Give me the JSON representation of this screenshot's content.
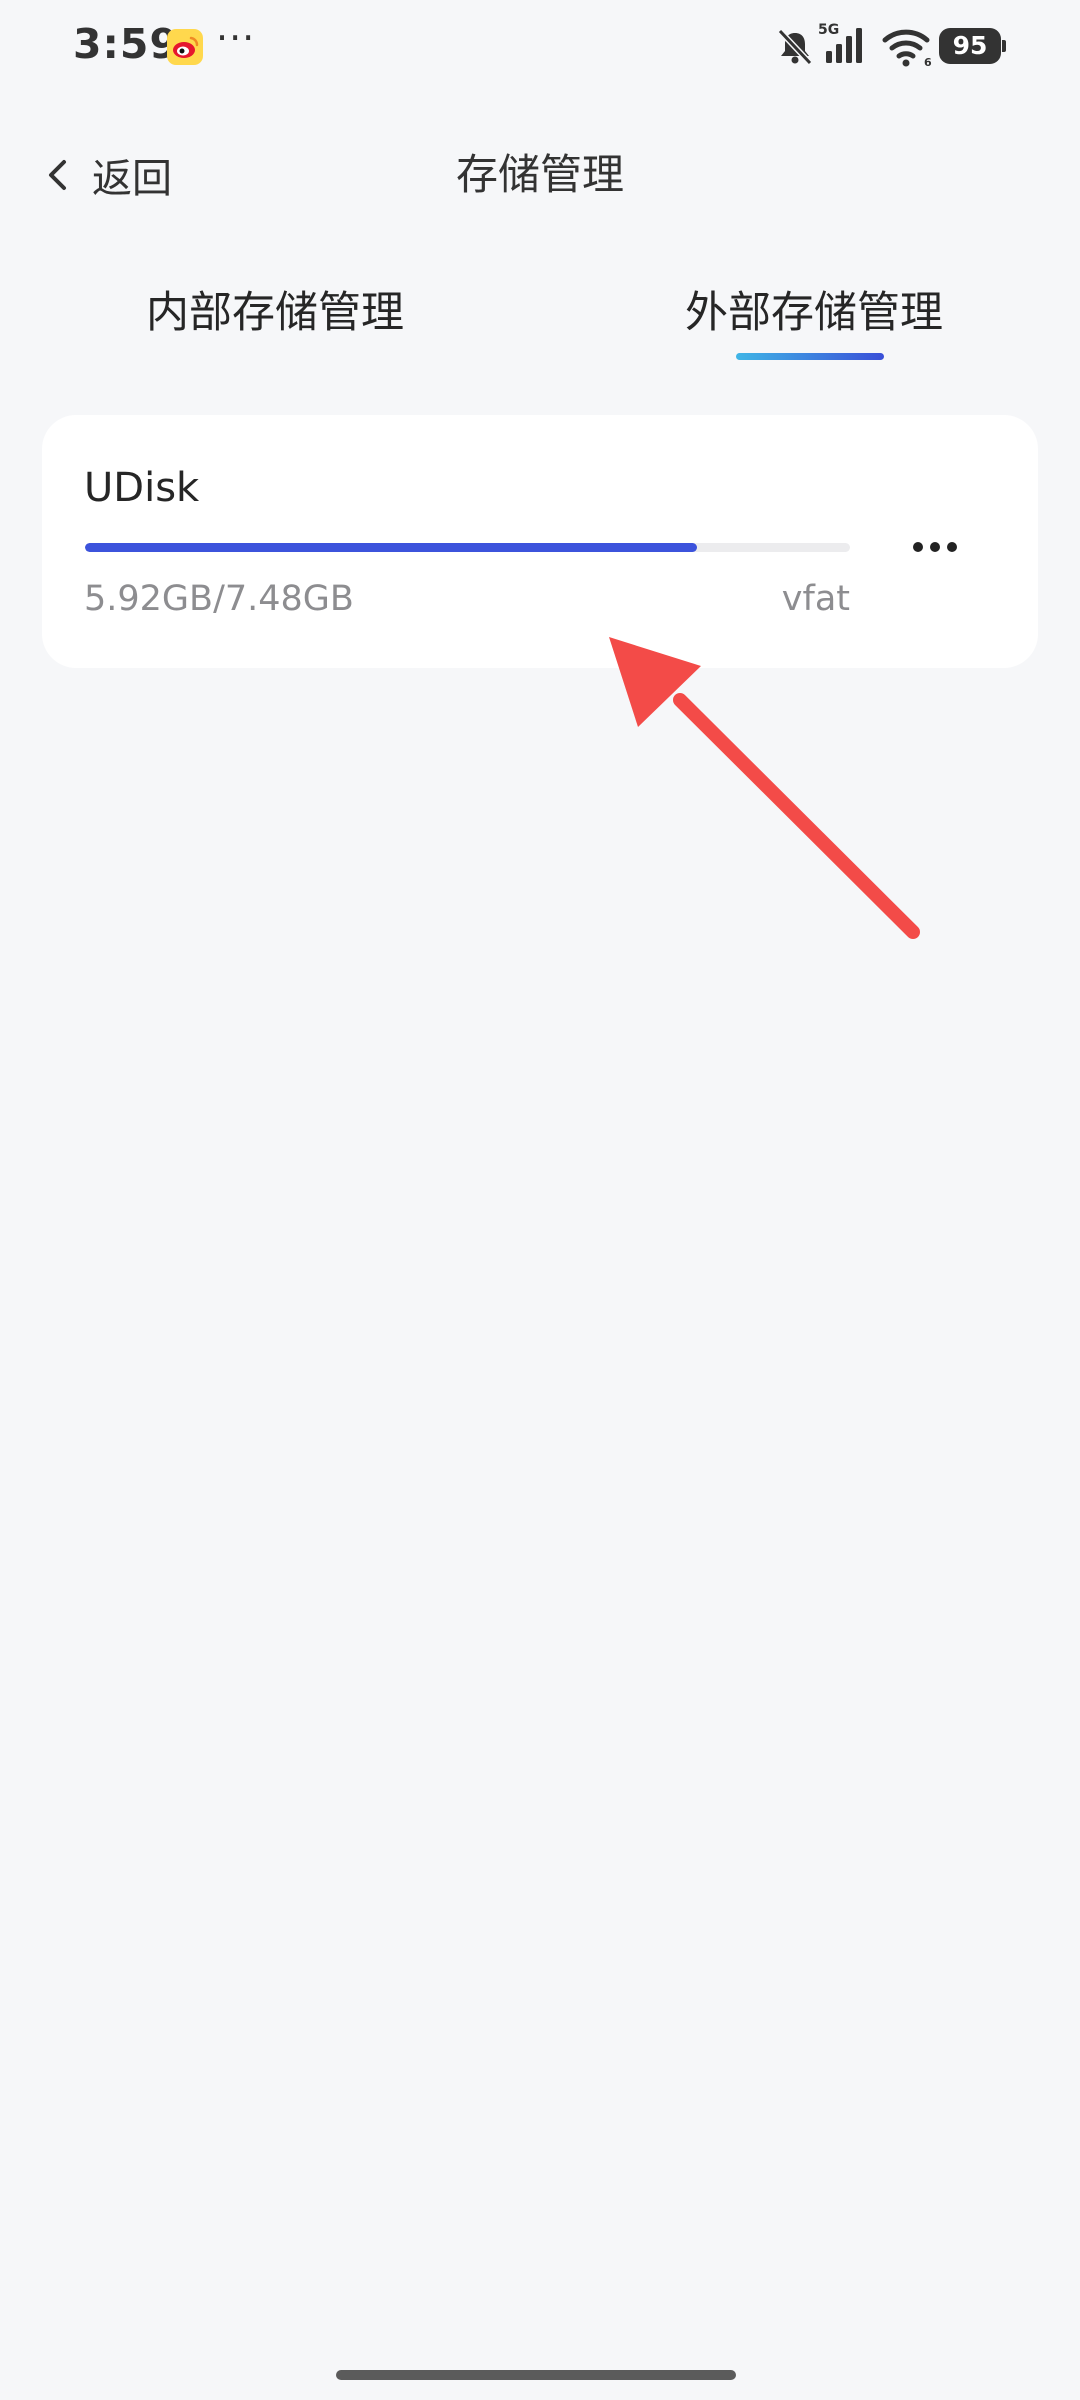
{
  "status_bar": {
    "time": "3:59",
    "more_dots": "···",
    "network": "5G",
    "battery": "95"
  },
  "header": {
    "back_label": "返回",
    "title": "存储管理"
  },
  "tabs": [
    {
      "label": "内部存储管理",
      "selected": false
    },
    {
      "label": "外部存储管理",
      "selected": true
    }
  ],
  "storage": {
    "name": "UDisk",
    "usage": "5.92GB/7.48GB",
    "filesystem": "vfat",
    "used_fraction": 0.8
  },
  "colors": {
    "accent": "#3c53dc",
    "annotation": "#f34b48"
  }
}
